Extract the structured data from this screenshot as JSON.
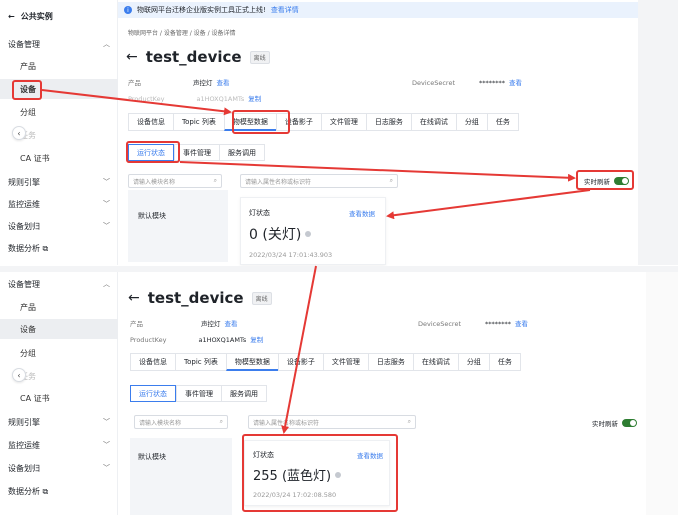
{
  "sidebar": {
    "back_title": "公共实例",
    "top": {
      "groups": [
        {
          "label": "设备管理",
          "chevron": "^"
        },
        {
          "label": "规则引擎",
          "chevron": "v"
        },
        {
          "label": "监控运维",
          "chevron": "v"
        },
        {
          "label": "设备划归",
          "chevron": "v"
        },
        {
          "label": "数据分析 ⧉",
          "chevron": ""
        }
      ],
      "items": [
        "产品",
        "设备",
        "分组",
        "任务",
        "CA 证书"
      ]
    },
    "bottom": {
      "groups": [
        {
          "label": "设备管理",
          "chevron": "^"
        },
        {
          "label": "规则引擎",
          "chevron": "v"
        },
        {
          "label": "监控运维",
          "chevron": "v"
        },
        {
          "label": "设备划归",
          "chevron": "v"
        },
        {
          "label": "数据分析 ⧉",
          "chevron": ""
        }
      ],
      "items": [
        "产品",
        "设备",
        "分组",
        "任务",
        "CA 证书"
      ]
    }
  },
  "notice": {
    "text": "物联网平台迁移企业版实例工具正式上线!",
    "link": "查看详情"
  },
  "breadcrumb": "物联网平台  /  设备管理  /  设备  /  设备详情",
  "device": {
    "name": "test_device",
    "status": "离线",
    "product_label": "产品",
    "product_value": "声控灯",
    "product_view": "查看",
    "productkey_label": "ProductKey",
    "productkey_value": "a1HOXQ1AMTs",
    "copy": "复制",
    "secret_label": "DeviceSecret",
    "secret_value": "********",
    "secret_view": "查看"
  },
  "tabs": [
    "设备信息",
    "Topic 列表",
    "物模型数据",
    "设备影子",
    "文件管理",
    "日志服务",
    "在线调试",
    "分组",
    "任务"
  ],
  "subtabs": [
    "运行状态",
    "事件管理",
    "服务调用"
  ],
  "search": {
    "module_placeholder": "请输入模块名称",
    "property_placeholder": "请输入属性名称或标识符"
  },
  "module": {
    "default": "默认模块"
  },
  "realtime": {
    "label": "实时刷新"
  },
  "card_top": {
    "label": "灯状态",
    "view": "查看数据",
    "value": "0 (关灯)",
    "timestamp": "2022/03/24 17:01:43.903"
  },
  "card_bottom": {
    "label": "灯状态",
    "view": "查看数据",
    "value": "255 (蓝色灯)",
    "timestamp": "2022/03/24 17:02:08.580"
  },
  "colors": {
    "accent": "#3b7ded",
    "annotation": "#e53935",
    "toggle_on": "#2e7d32"
  }
}
